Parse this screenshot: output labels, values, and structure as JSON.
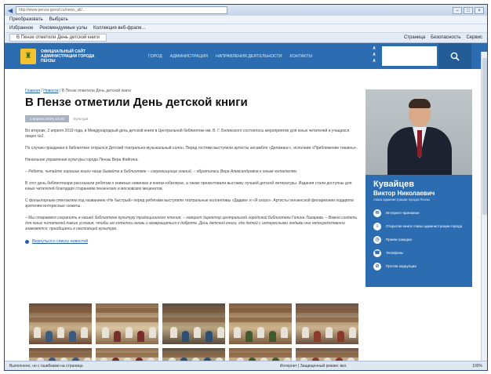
{
  "browser": {
    "address": "http://www.penza-gorod.ru/news_all/...",
    "menu": [
      "Преобразовать",
      "Выбрать"
    ],
    "favorites": [
      "Избранное",
      "Рекомендуемые узлы",
      "Коллекция веб-фрагм..."
    ],
    "tab": "В Пензе отметили День детской книги",
    "tools": [
      "Страница",
      "Безопасность",
      "Сервис"
    ],
    "status_left": "Выполнено, но с ошибками на странице.",
    "status_zone": "Интернет | Защищенный режим: вкл.",
    "zoom": "100%"
  },
  "site": {
    "logo_icon": "city-crest-icon",
    "org_name": "Официальный сайт администрации города Пензы",
    "nav": [
      "Город",
      "Администрация",
      "Направления деятельности",
      "Контакты"
    ],
    "accessibility": [
      "А",
      "А",
      "А"
    ],
    "search_icon": "search-icon"
  },
  "article": {
    "breadcrumb": {
      "home": "Главная",
      "section": "Новости",
      "current": "В Пензе отметили День детской книги"
    },
    "title": "В Пензе отметили День детской книги",
    "date": "2 апреля 2019, 10:16",
    "tag": "Культура",
    "paragraphs": [
      "Во вторник, 2 апреля 2019 года, в Международный день детской книги в Центральной библиотеке им. В. Г. Белинского состоялось мероприятие для юных читателей и учащихся лицея №2.",
      "По случаю праздника в библиотеке открылся Детский театрально-музыкальный салон. Перед гостями выступили артисты ансамбля «Дилижанс», исполнив «Приближение тишины».",
      "Начальник управления культуры города Пензы Вера Фейгина.",
      "– Ребята, читайте хорошие книги чаще бывайте в библиотеке – сокровищнице знаний, – обратилась Вера Александровна к юным читателям.",
      "В этот день библиотекари рассказали ребятам о книжных новинках и книгах-юбилярах, а также презентовали выставку лучшей детской литературы. Издания стали доступны для юных читателей благодаря стараниям пензенских и московских меценатов.",
      "С фольклорным спектаклем под названием «Не быстрый» перед ребятами выступили театральные коллективы «Дадим» и «Я скоро». Артисты пензенской филармонии подарили зрителям интересные сюжеты.",
      "– Мы стараемся сохранить в нашей библиотеке культуру традиционного чтения, – говорит директор центральной городской библиотеки Галина Лазарева. – Важно создать для юных читателей такие условия, чтобы им хотелось вновь и возвращаться к доброте. День детской книги, где детей с интересными людьми они непосредственно знакомятся, приобщаясь к настоящей культуре."
    ],
    "back_link": "Вернуться к списку новостей"
  },
  "sidebar": {
    "surname": "Кувайцев",
    "name": "Виктор Николаевич",
    "role": "глава администрации города Пензы",
    "links": [
      {
        "icon": "chat-icon",
        "label": "Интернет-приемная"
      },
      {
        "icon": "document-icon",
        "label": "Открытая книга главы администрации города"
      },
      {
        "icon": "calendar-icon",
        "label": "Прием граждан"
      },
      {
        "icon": "phone-icon",
        "label": "Телефоны"
      },
      {
        "icon": "no-corruption-icon",
        "label": "Против коррупции"
      }
    ]
  },
  "gallery": {
    "photo_count": 10
  },
  "colors": {
    "brand_blue": "#2c6db1",
    "link_blue": "#1f5ea8"
  }
}
